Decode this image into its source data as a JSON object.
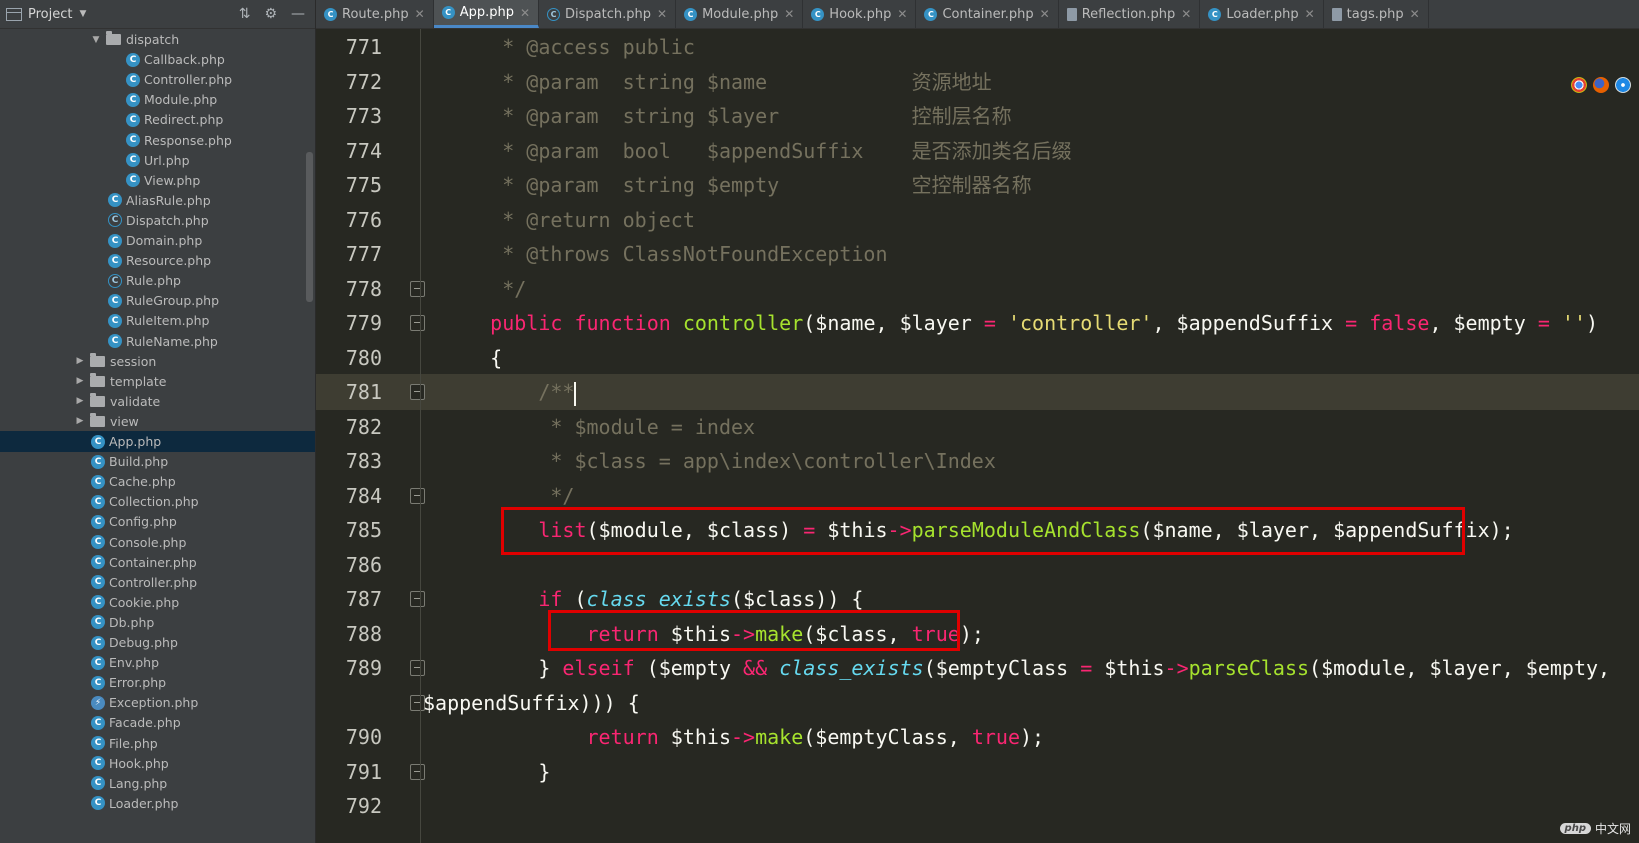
{
  "sidebar": {
    "title": "Project",
    "items": [
      {
        "type": "folder-open",
        "label": "dispatch"
      },
      {
        "type": "class",
        "label": "Callback.php"
      },
      {
        "type": "class",
        "label": "Controller.php"
      },
      {
        "type": "class",
        "label": "Module.php"
      },
      {
        "type": "class",
        "label": "Redirect.php"
      },
      {
        "type": "class",
        "label": "Response.php"
      },
      {
        "type": "class",
        "label": "Url.php"
      },
      {
        "type": "class",
        "label": "View.php"
      },
      {
        "type": "class",
        "label": "AliasRule.php"
      },
      {
        "type": "abstract",
        "label": "Dispatch.php"
      },
      {
        "type": "class",
        "label": "Domain.php"
      },
      {
        "type": "class",
        "label": "Resource.php"
      },
      {
        "type": "abstract",
        "label": "Rule.php"
      },
      {
        "type": "class",
        "label": "RuleGroup.php"
      },
      {
        "type": "class",
        "label": "RuleItem.php"
      },
      {
        "type": "class",
        "label": "RuleName.php"
      },
      {
        "type": "folder",
        "label": "session"
      },
      {
        "type": "folder",
        "label": "template"
      },
      {
        "type": "folder",
        "label": "validate"
      },
      {
        "type": "folder",
        "label": "view"
      },
      {
        "type": "class",
        "label": "App.php",
        "selected": true
      },
      {
        "type": "class",
        "label": "Build.php"
      },
      {
        "type": "class",
        "label": "Cache.php"
      },
      {
        "type": "class",
        "label": "Collection.php"
      },
      {
        "type": "class",
        "label": "Config.php"
      },
      {
        "type": "class",
        "label": "Console.php"
      },
      {
        "type": "class",
        "label": "Container.php"
      },
      {
        "type": "class",
        "label": "Controller.php"
      },
      {
        "type": "class",
        "label": "Cookie.php"
      },
      {
        "type": "class",
        "label": "Db.php"
      },
      {
        "type": "class",
        "label": "Debug.php"
      },
      {
        "type": "class",
        "label": "Env.php"
      },
      {
        "type": "class",
        "label": "Error.php"
      },
      {
        "type": "exception",
        "label": "Exception.php"
      },
      {
        "type": "class",
        "label": "Facade.php"
      },
      {
        "type": "class",
        "label": "File.php"
      },
      {
        "type": "class",
        "label": "Hook.php"
      },
      {
        "type": "class",
        "label": "Lang.php"
      },
      {
        "type": "class",
        "label": "Loader.php"
      }
    ]
  },
  "tabs": [
    {
      "label": "Route.php",
      "icon": "class",
      "active": false
    },
    {
      "label": "App.php",
      "icon": "class",
      "active": true
    },
    {
      "label": "Dispatch.php",
      "icon": "abstract",
      "active": false
    },
    {
      "label": "Module.php",
      "icon": "class",
      "active": false
    },
    {
      "label": "Hook.php",
      "icon": "class",
      "active": false
    },
    {
      "label": "Container.php",
      "icon": "class",
      "active": false
    },
    {
      "label": "Reflection.php",
      "icon": "file",
      "active": false
    },
    {
      "label": "Loader.php",
      "icon": "class",
      "active": false
    },
    {
      "label": "tags.php",
      "icon": "file",
      "active": false
    }
  ],
  "editor": {
    "lines": [
      {
        "num": "771",
        "fold": false,
        "segments": [
          [
            "cm",
            "     * @access public"
          ]
        ]
      },
      {
        "num": "772",
        "fold": false,
        "segments": [
          [
            "cm",
            "     * @param  string $name            "
          ],
          [
            "cmz",
            "资源地址"
          ]
        ]
      },
      {
        "num": "773",
        "fold": false,
        "segments": [
          [
            "cm",
            "     * @param  string $layer           "
          ],
          [
            "cmz",
            "控制层名称"
          ]
        ]
      },
      {
        "num": "774",
        "fold": false,
        "segments": [
          [
            "cm",
            "     * @param  bool   $appendSuffix    "
          ],
          [
            "cmz",
            "是否添加类名后缀"
          ]
        ]
      },
      {
        "num": "775",
        "fold": false,
        "segments": [
          [
            "cm",
            "     * @param  string $empty           "
          ],
          [
            "cmz",
            "空控制器名称"
          ]
        ]
      },
      {
        "num": "776",
        "fold": false,
        "segments": [
          [
            "cm",
            "     * @return object"
          ]
        ]
      },
      {
        "num": "777",
        "fold": false,
        "segments": [
          [
            "cm",
            "     * @throws ClassNotFoundException"
          ]
        ]
      },
      {
        "num": "778",
        "fold": true,
        "segments": [
          [
            "cm",
            "     */"
          ]
        ]
      },
      {
        "num": "779",
        "fold": true,
        "segments": [
          [
            "",
            "    "
          ],
          [
            "kw",
            "public function "
          ],
          [
            "fn",
            "controller"
          ],
          [
            "",
            "($name, $layer "
          ],
          [
            "kw",
            "="
          ],
          [
            "",
            " "
          ],
          [
            "str",
            "'controller'"
          ],
          [
            "",
            ", $appendSuffix "
          ],
          [
            "kw",
            "="
          ],
          [
            "",
            " "
          ],
          [
            "lit",
            "false"
          ],
          [
            "",
            ", $empty "
          ],
          [
            "kw",
            "="
          ],
          [
            "",
            " "
          ],
          [
            "str",
            "''"
          ],
          [
            "",
            ")"
          ]
        ]
      },
      {
        "num": "780",
        "fold": false,
        "segments": [
          [
            "",
            "    {"
          ]
        ]
      },
      {
        "num": "781",
        "fold": true,
        "highlight": true,
        "caret": true,
        "segments": [
          [
            "cm",
            "        /**"
          ]
        ]
      },
      {
        "num": "782",
        "fold": false,
        "segments": [
          [
            "cm",
            "         * $module = index"
          ]
        ]
      },
      {
        "num": "783",
        "fold": false,
        "segments": [
          [
            "cm",
            "         * $class = app\\index\\controller\\Index"
          ]
        ]
      },
      {
        "num": "784",
        "fold": true,
        "segments": [
          [
            "cm",
            "         */"
          ]
        ]
      },
      {
        "num": "785",
        "fold": false,
        "segments": [
          [
            "",
            "        "
          ],
          [
            "kw",
            "list"
          ],
          [
            "",
            "($module, $class) "
          ],
          [
            "kw",
            "="
          ],
          [
            "",
            " $this"
          ],
          [
            "kw",
            "->"
          ],
          [
            "fn",
            "parseModuleAndClass"
          ],
          [
            "",
            "($name, $layer, $appendSuffix);"
          ]
        ]
      },
      {
        "num": "786",
        "fold": false,
        "segments": [
          [
            "",
            ""
          ]
        ]
      },
      {
        "num": "787",
        "fold": true,
        "segments": [
          [
            "",
            "        "
          ],
          [
            "kw",
            "if"
          ],
          [
            "",
            " ("
          ],
          [
            "bi",
            "class_exists"
          ],
          [
            "",
            "($class)) {"
          ]
        ]
      },
      {
        "num": "788",
        "fold": false,
        "segments": [
          [
            "",
            "            "
          ],
          [
            "kw",
            "return"
          ],
          [
            "",
            " $this"
          ],
          [
            "kw",
            "->"
          ],
          [
            "fn",
            "make"
          ],
          [
            "",
            "($class, "
          ],
          [
            "lit",
            "true"
          ],
          [
            "",
            ");"
          ]
        ]
      },
      {
        "num": "789",
        "fold": true,
        "segments": [
          [
            "",
            "        } "
          ],
          [
            "kw",
            "elseif"
          ],
          [
            "",
            " ($empty "
          ],
          [
            "kw",
            "&&"
          ],
          [
            "",
            " "
          ],
          [
            "bi",
            "class_exists"
          ],
          [
            "",
            "($emptyClass "
          ],
          [
            "kw",
            "="
          ],
          [
            "",
            " $this"
          ],
          [
            "kw",
            "->"
          ],
          [
            "fn",
            "parseClass"
          ],
          [
            "",
            "($module, $layer, $empty,"
          ]
        ]
      },
      {
        "num": "",
        "fold": true,
        "wrap": true,
        "segments": [
          [
            "",
            "$appendSuffix))) {"
          ]
        ]
      },
      {
        "num": "790",
        "fold": false,
        "segments": [
          [
            "",
            "            "
          ],
          [
            "kw",
            "return"
          ],
          [
            "",
            " $this"
          ],
          [
            "kw",
            "->"
          ],
          [
            "fn",
            "make"
          ],
          [
            "",
            "($emptyClass, "
          ],
          [
            "lit",
            "true"
          ],
          [
            "",
            ");"
          ]
        ]
      },
      {
        "num": "791",
        "fold": true,
        "segments": [
          [
            "",
            "        }"
          ]
        ]
      },
      {
        "num": "792",
        "fold": false,
        "segments": [
          [
            "",
            ""
          ]
        ]
      }
    ]
  },
  "browser_icons": [
    "chrome-icon",
    "firefox-icon",
    "safari-icon"
  ],
  "watermark": {
    "badge": "php",
    "text": "中文网"
  },
  "colors": {
    "highlight_box": "#e00000",
    "keyword": "#f92672",
    "function": "#a6e22e",
    "string": "#e6db74",
    "comment": "#75715e"
  }
}
